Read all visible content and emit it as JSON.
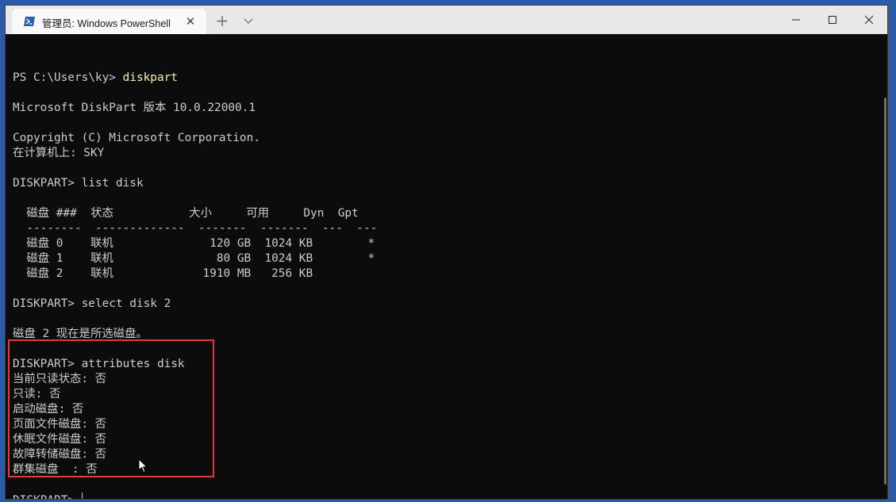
{
  "window": {
    "tab_title": "管理员: Windows PowerShell",
    "tab_close_glyph": "✕",
    "new_tab_glyph": "+"
  },
  "terminal": {
    "lines": [
      {
        "prompt": "",
        "cmd": "",
        "rest": ""
      },
      {
        "prompt": "PS C:\\Users\\ky> ",
        "cmd": "diskpart",
        "rest": ""
      },
      {
        "prompt": "",
        "cmd": "",
        "rest": ""
      },
      {
        "prompt": "",
        "cmd": "",
        "rest": "Microsoft DiskPart 版本 10.0.22000.1"
      },
      {
        "prompt": "",
        "cmd": "",
        "rest": ""
      },
      {
        "prompt": "",
        "cmd": "",
        "rest": "Copyright (C) Microsoft Corporation."
      },
      {
        "prompt": "",
        "cmd": "",
        "rest": "在计算机上: SKY"
      },
      {
        "prompt": "",
        "cmd": "",
        "rest": ""
      },
      {
        "prompt": "",
        "cmd": "",
        "rest": "DISKPART> list disk"
      },
      {
        "prompt": "",
        "cmd": "",
        "rest": ""
      },
      {
        "prompt": "",
        "cmd": "",
        "rest": "  磁盘 ###  状态           大小     可用     Dyn  Gpt"
      },
      {
        "prompt": "",
        "cmd": "",
        "rest": "  --------  -------------  -------  -------  ---  ---"
      },
      {
        "prompt": "",
        "cmd": "",
        "rest": "  磁盘 0    联机              120 GB  1024 KB        *"
      },
      {
        "prompt": "",
        "cmd": "",
        "rest": "  磁盘 1    联机               80 GB  1024 KB        *"
      },
      {
        "prompt": "",
        "cmd": "",
        "rest": "  磁盘 2    联机             1910 MB   256 KB"
      },
      {
        "prompt": "",
        "cmd": "",
        "rest": ""
      },
      {
        "prompt": "",
        "cmd": "",
        "rest": "DISKPART> select disk 2"
      },
      {
        "prompt": "",
        "cmd": "",
        "rest": ""
      },
      {
        "prompt": "",
        "cmd": "",
        "rest": "磁盘 2 现在是所选磁盘。"
      },
      {
        "prompt": "",
        "cmd": "",
        "rest": ""
      },
      {
        "prompt": "",
        "cmd": "",
        "rest": "DISKPART> attributes disk"
      },
      {
        "prompt": "",
        "cmd": "",
        "rest": "当前只读状态: 否"
      },
      {
        "prompt": "",
        "cmd": "",
        "rest": "只读: 否"
      },
      {
        "prompt": "",
        "cmd": "",
        "rest": "启动磁盘: 否"
      },
      {
        "prompt": "",
        "cmd": "",
        "rest": "页面文件磁盘: 否"
      },
      {
        "prompt": "",
        "cmd": "",
        "rest": "休眠文件磁盘: 否"
      },
      {
        "prompt": "",
        "cmd": "",
        "rest": "故障转储磁盘: 否"
      },
      {
        "prompt": "",
        "cmd": "",
        "rest": "群集磁盘  : 否"
      },
      {
        "prompt": "",
        "cmd": "",
        "rest": ""
      },
      {
        "prompt": "",
        "cmd": "",
        "rest": "DISKPART> "
      }
    ],
    "colors": {
      "background": "#0c0c0c",
      "text": "#cccccc",
      "command": "#f9f1a5",
      "highlight_border": "#e03c3c"
    }
  },
  "icons": {
    "tab_icon": "powershell-icon",
    "dropdown": "chevron-down-icon",
    "minimize": "minimize-icon",
    "maximize": "maximize-icon",
    "close": "close-icon",
    "pointer": "mouse-pointer-icon"
  }
}
